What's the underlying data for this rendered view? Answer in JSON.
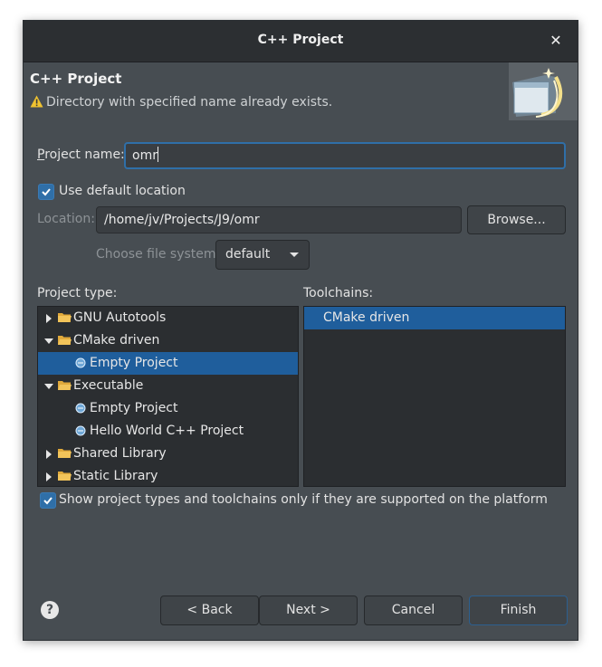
{
  "window": {
    "title": "C++ Project",
    "close_glyph": "✕"
  },
  "header": {
    "title": "C++ Project",
    "warning": "Directory with specified name already exists.",
    "warning_icon": "warning-icon"
  },
  "project_name": {
    "label": "Project name:",
    "value": "omr"
  },
  "use_default_location": {
    "label": "Use default location",
    "checked": true
  },
  "location": {
    "label": "Location:",
    "value": "/home/jv/Projects/J9/omr",
    "browse_label": "Browse..."
  },
  "file_system": {
    "label": "Choose file system:",
    "value": "default"
  },
  "project_type": {
    "label": "Project type:",
    "items": [
      {
        "label": "GNU Autotools",
        "kind": "folder",
        "expanded": false
      },
      {
        "label": "CMake driven",
        "kind": "folder",
        "expanded": true
      },
      {
        "label": "Empty Project",
        "kind": "leaf",
        "selected": true
      },
      {
        "label": "Executable",
        "kind": "folder",
        "expanded": true
      },
      {
        "label": "Empty Project",
        "kind": "leaf"
      },
      {
        "label": "Hello World C++ Project",
        "kind": "leaf"
      },
      {
        "label": "Shared Library",
        "kind": "folder",
        "expanded": false
      },
      {
        "label": "Static Library",
        "kind": "folder",
        "expanded": false
      }
    ]
  },
  "toolchains": {
    "label": "Toolchains:",
    "items": [
      {
        "label": "CMake driven",
        "selected": true
      }
    ]
  },
  "show_supported": {
    "label": "Show project types and toolchains only if they are supported on the platform",
    "checked": true
  },
  "buttons": {
    "help": "?",
    "back": "< Back",
    "next": "Next >",
    "cancel": "Cancel",
    "finish": "Finish"
  },
  "colors": {
    "accent": "#1f5e9c",
    "background": "#474d52",
    "panel": "#2b2e31",
    "warning": "#f0c330"
  }
}
